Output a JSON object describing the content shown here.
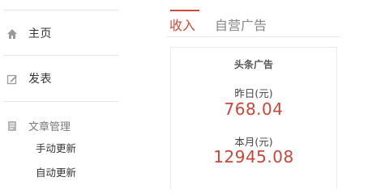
{
  "sidebar": {
    "home": {
      "label": "主页",
      "icon": "home-icon"
    },
    "publish": {
      "label": "发表",
      "icon": "edit-icon"
    },
    "article_management": {
      "label": "文章管理",
      "icon": "document-icon",
      "items": [
        {
          "label": "手动更新"
        },
        {
          "label": "自动更新"
        }
      ]
    }
  },
  "tabs": [
    {
      "label": "收入",
      "active": true
    },
    {
      "label": "自营广告",
      "active": false
    }
  ],
  "card": {
    "title": "头条广告",
    "yesterday": {
      "label": "昨日(元)",
      "value": "768.04"
    },
    "month": {
      "label": "本月(元)",
      "value": "12945.08"
    }
  },
  "colors": {
    "accent": "#d04a3a",
    "divider": "#e6e6e6",
    "muted_text": "#888888"
  }
}
